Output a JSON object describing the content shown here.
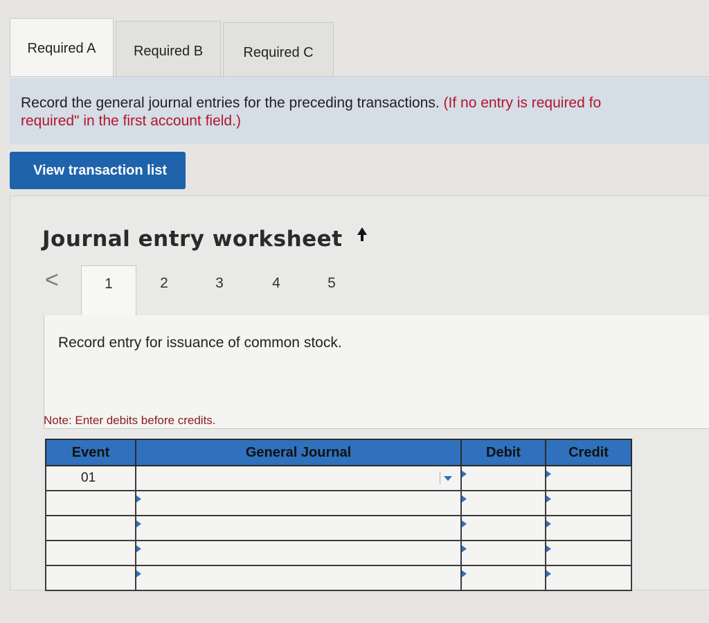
{
  "tabs": [
    {
      "label": "Required A",
      "active": true
    },
    {
      "label": "Required B",
      "active": false
    },
    {
      "label": "Required C",
      "active": false
    }
  ],
  "instructions": {
    "main": "Record the general journal entries for the preceding transactions. ",
    "red": "(If no entry is required fo",
    "line2": "required\" in the first account field.)"
  },
  "view_button": "View transaction list",
  "worksheet": {
    "title": "Journal entry worksheet",
    "prev_arrow": "<",
    "entry_tabs": [
      "1",
      "2",
      "3",
      "4",
      "5"
    ],
    "active_entry": "1",
    "entry_description": "Record entry for issuance of common stock.",
    "note": "Note: Enter debits before credits."
  },
  "table": {
    "headers": {
      "event": "Event",
      "general_journal": "General Journal",
      "debit": "Debit",
      "credit": "Credit"
    },
    "rows": [
      {
        "event": "01",
        "account": "",
        "debit": "",
        "credit": ""
      },
      {
        "event": "",
        "account": "",
        "debit": "",
        "credit": ""
      },
      {
        "event": "",
        "account": "",
        "debit": "",
        "credit": ""
      },
      {
        "event": "",
        "account": "",
        "debit": "",
        "credit": ""
      },
      {
        "event": "",
        "account": "",
        "debit": "",
        "credit": ""
      }
    ]
  },
  "colors": {
    "accent": "#1f63ac",
    "header": "#2f71bd",
    "instruction_bg": "#d5dde6",
    "warning_text": "#b3152b"
  }
}
